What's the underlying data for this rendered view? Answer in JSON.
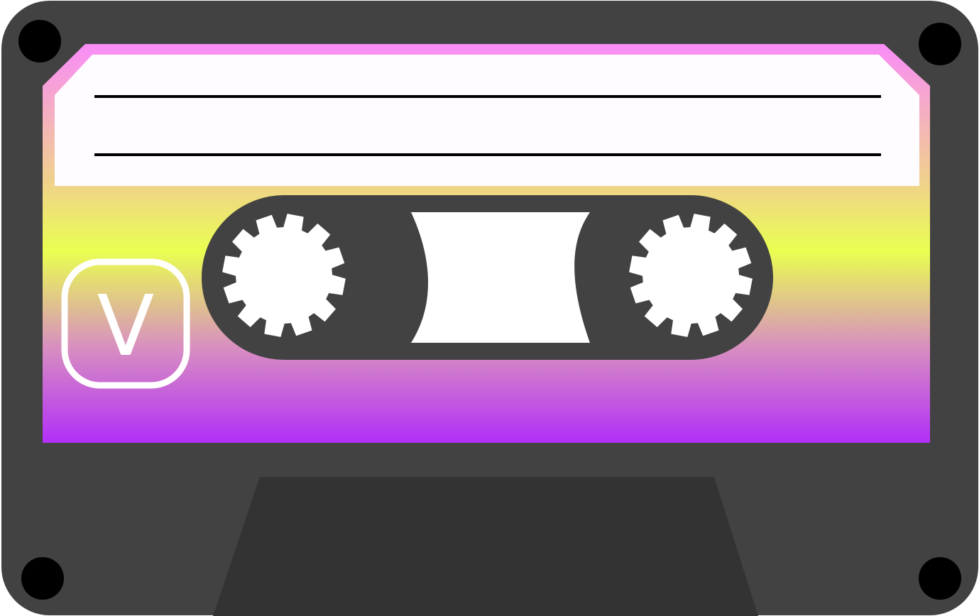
{
  "cassette": {
    "side_label": "V",
    "colors": {
      "shell": "#424242",
      "shell_bottom_tab": "#333333",
      "screw_holes": "#000000",
      "label_border": "#f98cf8",
      "label_writing_area": "#fffcff",
      "label_lines": "#000000",
      "window_and_reels": "#ffffff",
      "gradient_stops": [
        "#f98cf8",
        "#f0d28a",
        "#e9ff50",
        "#d88fc0",
        "#b22ff8"
      ]
    },
    "icons": {
      "screws": "screw-hole-icon",
      "reels": "tape-reel-icon",
      "badge": "side-badge-icon"
    }
  }
}
